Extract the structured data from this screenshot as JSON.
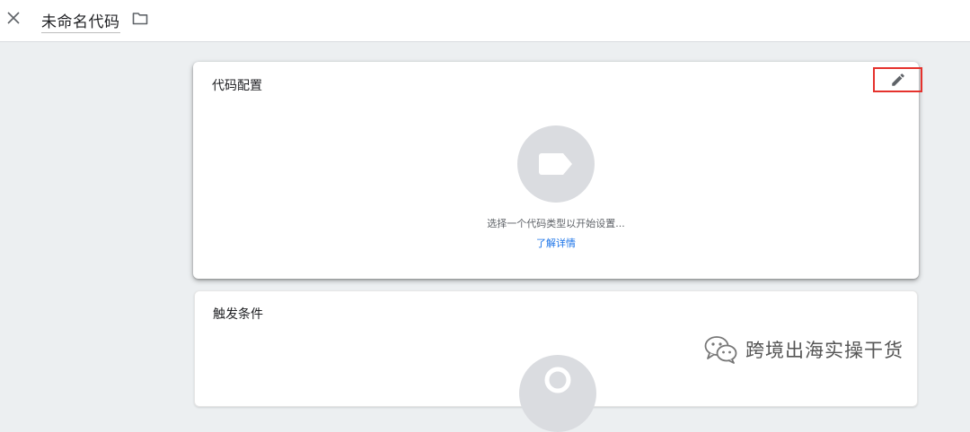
{
  "header": {
    "title": "未命名代码",
    "close_icon": "close-icon",
    "folder_icon": "folder-icon"
  },
  "config_card": {
    "title": "代码配置",
    "edit_icon": "pencil-icon",
    "placeholder_icon": "tag-icon",
    "hint": "选择一个代码类型以开始设置...",
    "learn_more": "了解详情"
  },
  "trigger_card": {
    "title": "触发条件",
    "placeholder_icon": "trigger-icon"
  },
  "watermark": {
    "text": "跨境出海实操干货",
    "icon": "wechat-icon"
  },
  "colors": {
    "background": "#eceff1",
    "card": "#ffffff",
    "placeholder": "#dadce0",
    "link": "#1a73e8",
    "highlight": "#e5322d"
  }
}
